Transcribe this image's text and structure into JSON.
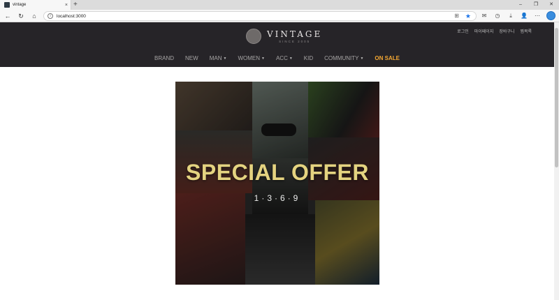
{
  "browser": {
    "tab_title": "vintage",
    "tab_close": "×",
    "new_tab": "+",
    "url": "localhost:3000",
    "window_controls": [
      "–",
      "❐",
      "✕"
    ],
    "nav_icons": [
      "back-icon",
      "refresh-icon",
      "home-icon"
    ],
    "toolbar_icons": [
      "mail-icon",
      "history-icon",
      "download-icon",
      "account-icon",
      "more-icon"
    ]
  },
  "header": {
    "logo_name": "VINTAGE",
    "logo_since": "SINCE 2005",
    "util_links": [
      "로그인",
      "마이페이지",
      "장바구니",
      "찜목록"
    ]
  },
  "menu": [
    {
      "label": "BRAND",
      "dropdown": false
    },
    {
      "label": "NEW",
      "dropdown": false
    },
    {
      "label": "MAN",
      "dropdown": true
    },
    {
      "label": "WOMEN",
      "dropdown": true
    },
    {
      "label": "ACC",
      "dropdown": true
    },
    {
      "label": "KID",
      "dropdown": false
    },
    {
      "label": "COMMUNITY",
      "dropdown": true
    },
    {
      "label": "ON SALE",
      "dropdown": false,
      "highlight": "#f5a833"
    }
  ],
  "menu_caret": "▼",
  "banner": {
    "title": "SPECIAL OFFER",
    "dates": "1·3·6·9"
  },
  "colors": {
    "header_bg": "#262428",
    "sale_accent": "#f5a833",
    "banner_title": "#e4d380",
    "bookmark_star": "#1a73e8"
  }
}
